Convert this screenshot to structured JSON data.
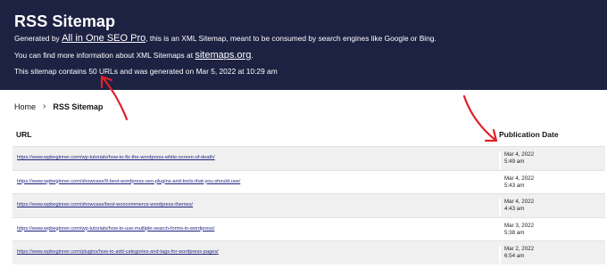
{
  "header": {
    "title": "RSS Sitemap",
    "line1_prefix": "Generated by",
    "line1_link": "All in One SEO Pro",
    "line1_suffix": ", this is an XML Sitemap, meant to be consumed by search engines like Google or Bing.",
    "line2_prefix": "You can find more information about XML Sitemaps at",
    "line2_link": "sitemaps.org",
    "line2_suffix": ".",
    "line3": "This sitemap contains 50 URLs and was generated on Mar 5, 2022 at 10:29 am"
  },
  "breadcrumb": {
    "home": "Home",
    "separator": "›",
    "current": "RSS Sitemap"
  },
  "table": {
    "col_url": "URL",
    "col_date": "Publication Date",
    "rows": [
      {
        "url": "https://www.wpbeginner.com/wp-tutorials/how-to-fix-the-wordpress-white-screen-of-death/",
        "date": "Mar 4, 2022",
        "time": "5:49 am"
      },
      {
        "url": "https://www.wpbeginner.com/showcase/9-best-wordpress-seo-plugins-and-tools-that-you-should-use/",
        "date": "Mar 4, 2022",
        "time": "5:43 am"
      },
      {
        "url": "https://www.wpbeginner.com/showcase/best-woocommerce-wordpress-themes/",
        "date": "Mar 4, 2022",
        "time": "4:43 am"
      },
      {
        "url": "https://www.wpbeginner.com/wp-tutorials/how-to-use-multiple-search-forms-in-wordpress/",
        "date": "Mar 3, 2022",
        "time": "5:38 am"
      },
      {
        "url": "https://www.wpbeginner.com/plugins/how-to-add-categories-and-tags-for-wordpress-pages/",
        "date": "Mar 2, 2022",
        "time": "6:54 am"
      }
    ]
  },
  "colors": {
    "header_bg": "#1d2142",
    "link": "#1b1e7e",
    "annotation_arrow": "#e0202a"
  }
}
